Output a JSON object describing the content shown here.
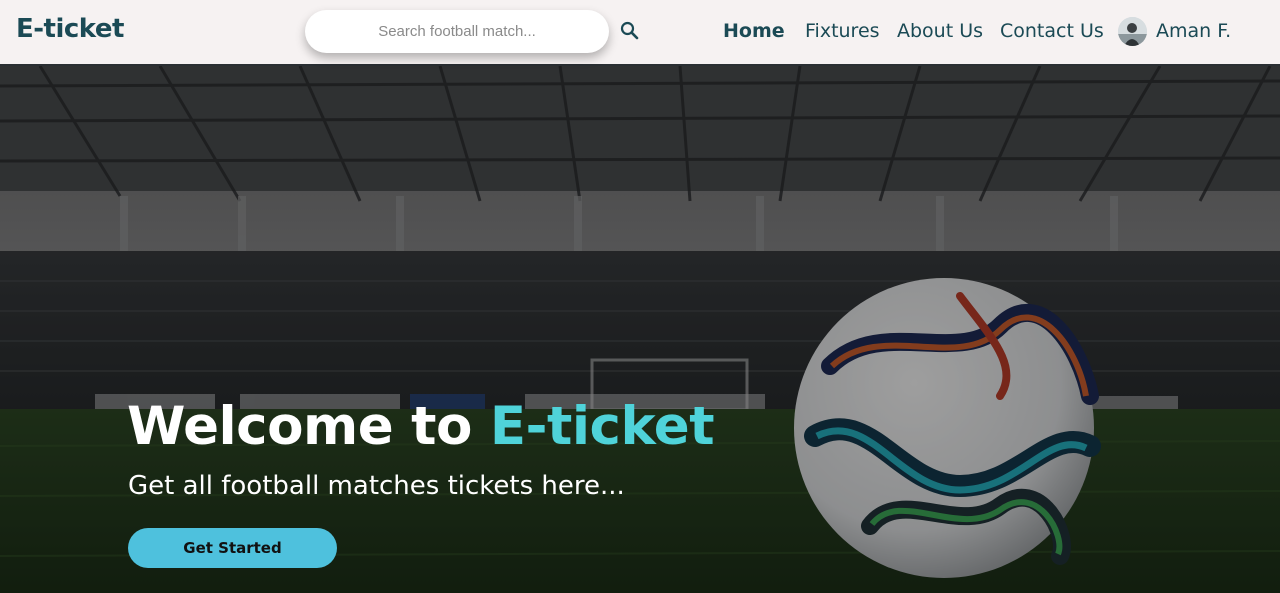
{
  "header": {
    "brand": "E-ticket",
    "search": {
      "placeholder": "Search football match...",
      "value": "",
      "icon": "search-icon"
    },
    "nav": [
      {
        "label": "Home",
        "active": true
      },
      {
        "label": "Fixtures",
        "active": false
      },
      {
        "label": "About Us",
        "active": false
      },
      {
        "label": "Contact Us",
        "active": false
      }
    ],
    "user": {
      "name": "Aman F.",
      "avatar_icon": "avatar"
    }
  },
  "hero": {
    "title_prefix": "Welcome to ",
    "title_accent": "E-ticket",
    "subtitle": "Get all football matches tickets here...",
    "cta_label": "Get Started",
    "background": "stadium-with-football-image"
  },
  "colors": {
    "brand_text": "#1b4a55",
    "accent": "#4fd3d9",
    "button": "#4ec1dd",
    "header_bg": "#f6f2f2"
  }
}
